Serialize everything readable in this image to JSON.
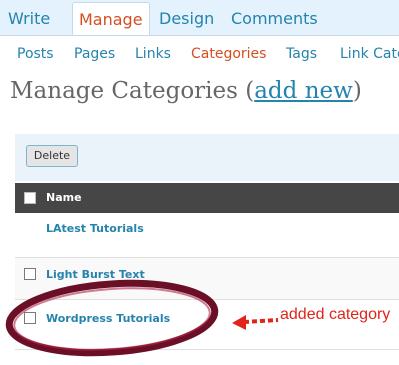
{
  "top_menu": {
    "items": [
      {
        "label": "Write",
        "active": false
      },
      {
        "label": "Manage",
        "active": true
      },
      {
        "label": "Design",
        "active": false
      },
      {
        "label": "Comments",
        "active": false
      }
    ]
  },
  "sub_menu": {
    "items": [
      {
        "label": "Posts",
        "active": false
      },
      {
        "label": "Pages",
        "active": false
      },
      {
        "label": "Links",
        "active": false
      },
      {
        "label": "Categories",
        "active": true
      },
      {
        "label": "Tags",
        "active": false
      },
      {
        "label": "Link Cate",
        "active": false
      }
    ]
  },
  "heading": {
    "prefix": "Manage Categories (",
    "link": "add new",
    "suffix": ")"
  },
  "actions": {
    "delete_label": "Delete"
  },
  "table": {
    "header": "Name",
    "rows": [
      {
        "name": "LAtest Tutorials",
        "has_checkbox": false
      },
      {
        "name": "Light Burst Text",
        "has_checkbox": true
      },
      {
        "name": "Wordpress Tutorials",
        "has_checkbox": true
      }
    ]
  },
  "annotation": {
    "label": "added category",
    "color": "#e0241b"
  },
  "colors": {
    "link": "#2583ad",
    "active": "#d54e21",
    "header_bg": "#464646",
    "menu_bg": "#e4f2fd"
  }
}
